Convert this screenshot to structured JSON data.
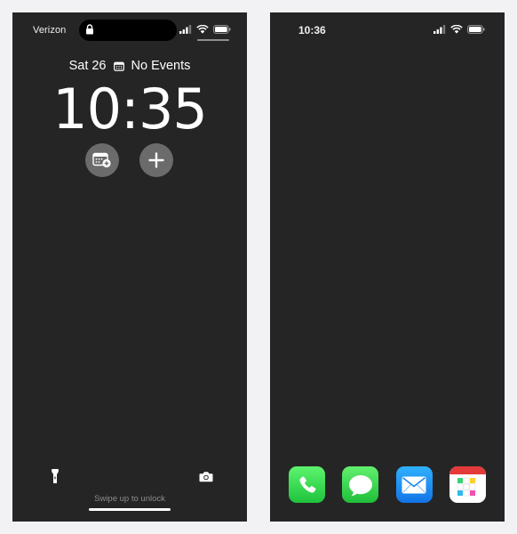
{
  "lock_screen": {
    "carrier": "Verizon",
    "date": "Sat 26",
    "events": "No Events",
    "time": "10:35",
    "swipe_hint": "Swipe up to unlock",
    "widgets": [
      "calendar-add-icon",
      "plus-icon"
    ],
    "bottom_controls": [
      "flashlight-icon",
      "camera-icon"
    ]
  },
  "home_screen": {
    "time": "10:36",
    "dock_apps": [
      "Phone",
      "Messages",
      "Mail",
      "Fantastical"
    ]
  },
  "colors": {
    "screen_bg": "#262526",
    "page_bg": "#f2f2f4",
    "widget_bg": "#6b6b6b",
    "phone_green": "#1fc33c",
    "mail_blue": "#1274e6"
  }
}
